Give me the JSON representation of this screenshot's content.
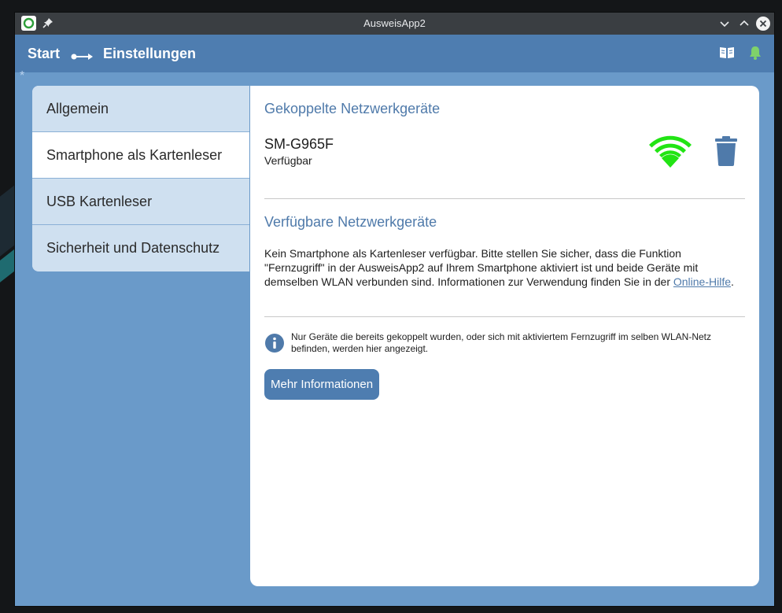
{
  "window": {
    "title": "AusweisApp2",
    "app_icon": "ausweisapp-logo-icon",
    "controls": [
      "pin-icon",
      "minimize-icon",
      "maximize-icon",
      "close-icon"
    ]
  },
  "navbar": {
    "crumb_start": "Start",
    "crumb_separator_icon": "arrow-right-icon",
    "crumb_current": "Einstellungen",
    "icons": [
      "help-book-icon",
      "notification-bell-icon"
    ],
    "accent_color": "#4e7db0"
  },
  "debug_marker": "*",
  "sidebar": {
    "items": [
      {
        "label": "Allgemein",
        "active": false
      },
      {
        "label": "Smartphone als Kartenleser",
        "active": true
      },
      {
        "label": "USB Kartenleser",
        "active": false
      },
      {
        "label": "Sicherheit und Datenschutz",
        "active": false
      }
    ]
  },
  "content": {
    "paired_heading": "Gekoppelte Netzwerkgeräte",
    "paired_device": {
      "name": "SM-G965F",
      "status": "Verfügbar",
      "signal_icon": "wifi-signal-icon",
      "signal_color": "#22e414",
      "remove_icon": "trash-icon"
    },
    "available_heading": "Verfügbare Netzwerkgeräte",
    "available_text": "Kein Smartphone als Kartenleser verfügbar. Bitte stellen Sie sicher, dass die Funktion \"Fernzugriff\" in der AusweisApp2 auf Ihrem Smartphone aktiviert ist und beide Geräte mit demselben WLAN verbunden sind. Informationen zur Verwendung finden Sie in der ",
    "help_link": "Online-Hilfe",
    "available_text_end": ".",
    "hint_icon": "info-icon",
    "hint": "Nur Geräte die bereits gekoppelt wurden, oder sich mit aktiviertem Fernzugriff im selben WLAN-Netz befinden, werden hier angezeigt.",
    "more_button": "Mehr Informationen"
  }
}
